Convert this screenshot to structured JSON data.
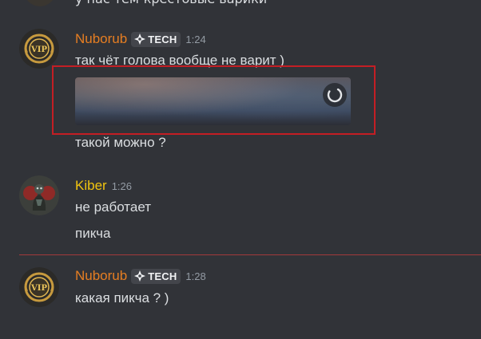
{
  "colors": {
    "background": "#313338",
    "username_nuborub": "#e67e22",
    "username_kiber": "#f1c40f",
    "text": "#dbdee1",
    "timestamp": "#949ba4",
    "tag_bg": "#43454b",
    "highlight": "#c41e24",
    "new_divider": "#a3393b"
  },
  "previous_message": {
    "text": "у нас тем-крестовые варики"
  },
  "messages": [
    {
      "author": "Nuborub",
      "avatar": "vip-badge-avatar",
      "tag": "TECH",
      "tag_icon": "tech-gem-icon",
      "time": "1:24",
      "lines": [
        "так чёт голова вообще не варит )"
      ],
      "attachment": {
        "state": "loading",
        "icon": "loading-spinner-icon"
      },
      "after_attachment": "такой можно ?"
    },
    {
      "author": "Kiber",
      "avatar": "creature-avatar",
      "time": "1:26",
      "lines": [
        "не работает",
        "пикча"
      ]
    },
    {
      "author": "Nuborub",
      "avatar": "vip-badge-avatar",
      "tag": "TECH",
      "tag_icon": "tech-gem-icon",
      "time": "1:28",
      "lines": [
        "какая пикча ? )"
      ]
    }
  ]
}
